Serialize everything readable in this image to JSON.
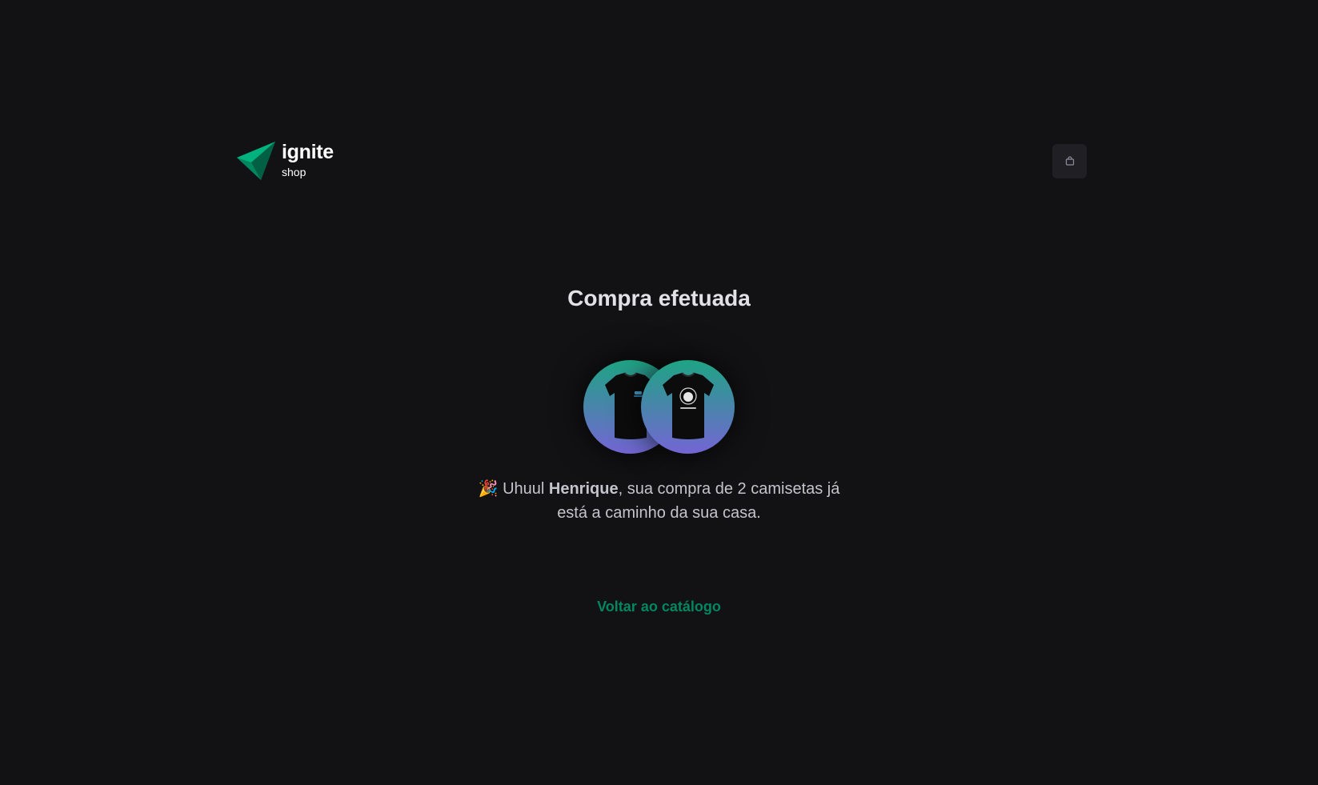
{
  "header": {
    "logo_title": "ignite",
    "logo_subtitle": "shop",
    "cart_icon": "bag-icon"
  },
  "success": {
    "title": "Compra efetuada",
    "emoji": "🎉",
    "message_prefix": "Uhuul ",
    "customer_name": "Henrique",
    "message_suffix": ", sua compra de 2 camisetas já está a caminho da sua casa.",
    "back_link": "Voltar ao catálogo"
  },
  "products": [
    {
      "image": "t-shirt-icon"
    },
    {
      "image": "t-shirt-icon"
    }
  ],
  "colors": {
    "background": "#121214",
    "accent": "#00875f",
    "gradient_start": "#1ea483",
    "gradient_end": "#7465d4"
  }
}
